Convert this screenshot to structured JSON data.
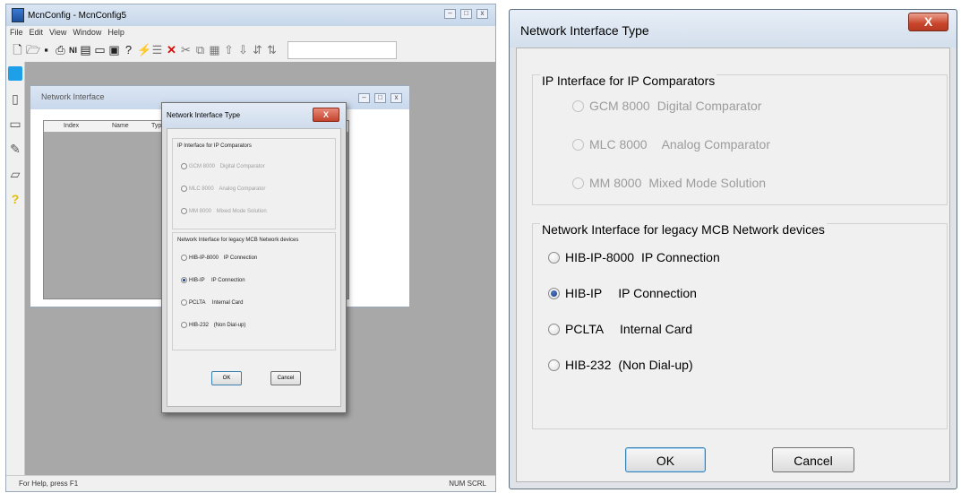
{
  "app": {
    "title": "McnConfig - McnConfig5",
    "menu": [
      "File",
      "Edit",
      "View",
      "Window",
      "Help"
    ],
    "toolbar_ni": "NI",
    "status_left": "For Help, press F1",
    "status_right": "NUM SCRL"
  },
  "child_window": {
    "title": "Network Interface",
    "columns": [
      "Index",
      "Name",
      "Type"
    ]
  },
  "dialog": {
    "title": "Network Interface Type",
    "close_glyph": "X",
    "ip_group": {
      "label": "IP Interface for IP Comparators",
      "options": [
        {
          "model": "GCM 8000",
          "desc": "Digital Comparator"
        },
        {
          "model": "MLC 8000",
          "desc": "Analog Comparator"
        },
        {
          "model": "MM 8000",
          "desc": "Mixed Mode Solution"
        }
      ]
    },
    "legacy_group": {
      "label": "Network Interface for legacy MCB Network devices",
      "options": [
        {
          "model": "HIB-IP-8000",
          "desc": "IP Connection"
        },
        {
          "model": "HIB-IP",
          "desc": "IP Connection"
        },
        {
          "model": "PCLTA",
          "desc": "Internal Card"
        },
        {
          "model": "HIB-232",
          "desc": "(Non Dial-up)"
        }
      ],
      "selected_index": 1
    },
    "ok_label": "OK",
    "cancel_label": "Cancel"
  }
}
